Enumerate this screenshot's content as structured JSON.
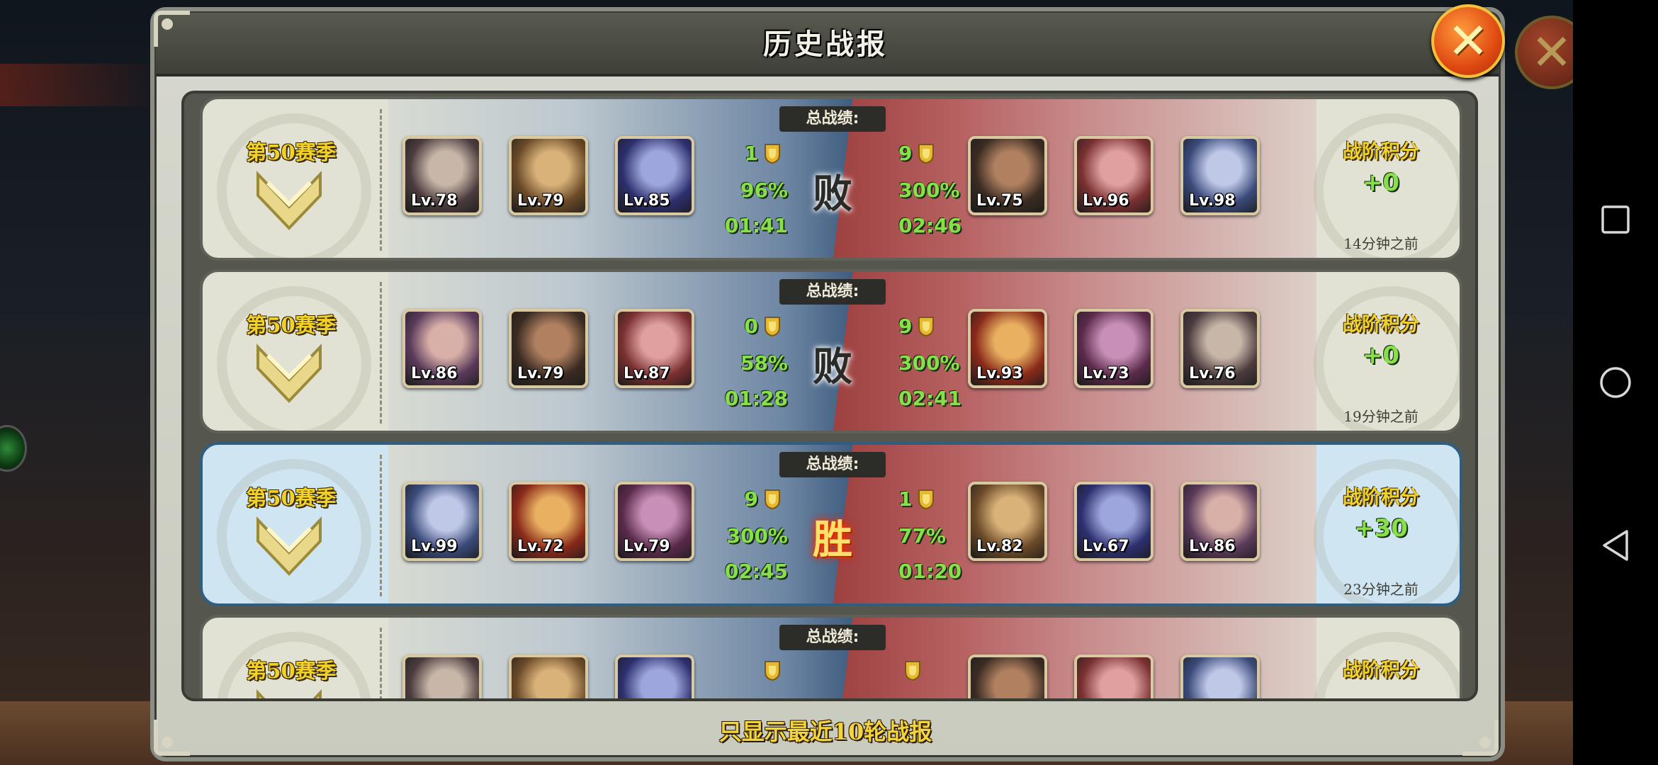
{
  "window": {
    "title": "历史战报",
    "footer": "只显示最近10轮战报"
  },
  "buttons": {
    "close_icon": "close-x-icon"
  },
  "labels": {
    "total_record": "总战绩:",
    "points_title": "战阶积分"
  },
  "android_nav": [
    "square-recent-icon",
    "circle-home-icon",
    "triangle-back-icon"
  ],
  "colors": {
    "accent_yellow": "#f1d12c",
    "stat_green": "#86e04a",
    "win_blue": "#cfe5f2",
    "close_orange": "#e04a12"
  },
  "reports": [
    {
      "season": "第50赛季",
      "result": "败",
      "result_type": "lose",
      "left": {
        "heroes": [
          "Lv.78",
          "Lv.79",
          "Lv.85"
        ],
        "score": "1",
        "rate": "96%",
        "time": "01:41"
      },
      "right": {
        "heroes": [
          "Lv.75",
          "Lv.96",
          "Lv.98"
        ],
        "score": "9",
        "rate": "300%",
        "time": "02:46"
      },
      "points": "+0",
      "ago": "14分钟之前"
    },
    {
      "season": "第50赛季",
      "result": "败",
      "result_type": "lose",
      "left": {
        "heroes": [
          "Lv.86",
          "Lv.79",
          "Lv.87"
        ],
        "score": "0",
        "rate": "58%",
        "time": "01:28"
      },
      "right": {
        "heroes": [
          "Lv.93",
          "Lv.73",
          "Lv.76"
        ],
        "score": "9",
        "rate": "300%",
        "time": "02:41"
      },
      "points": "+0",
      "ago": "19分钟之前"
    },
    {
      "season": "第50赛季",
      "result": "胜",
      "result_type": "win",
      "left": {
        "heroes": [
          "Lv.99",
          "Lv.72",
          "Lv.79"
        ],
        "score": "9",
        "rate": "300%",
        "time": "02:45"
      },
      "right": {
        "heroes": [
          "Lv.82",
          "Lv.67",
          "Lv.86"
        ],
        "score": "1",
        "rate": "77%",
        "time": "01:20"
      },
      "points": "+30",
      "ago": "23分钟之前"
    },
    {
      "season": "第50赛季",
      "result": "",
      "result_type": "partial",
      "left": {
        "heroes": [
          "",
          "",
          ""
        ],
        "score": "",
        "rate": "",
        "time": ""
      },
      "right": {
        "heroes": [
          "",
          "",
          ""
        ],
        "score": "",
        "rate": "",
        "time": ""
      },
      "points": "",
      "ago": ""
    }
  ]
}
